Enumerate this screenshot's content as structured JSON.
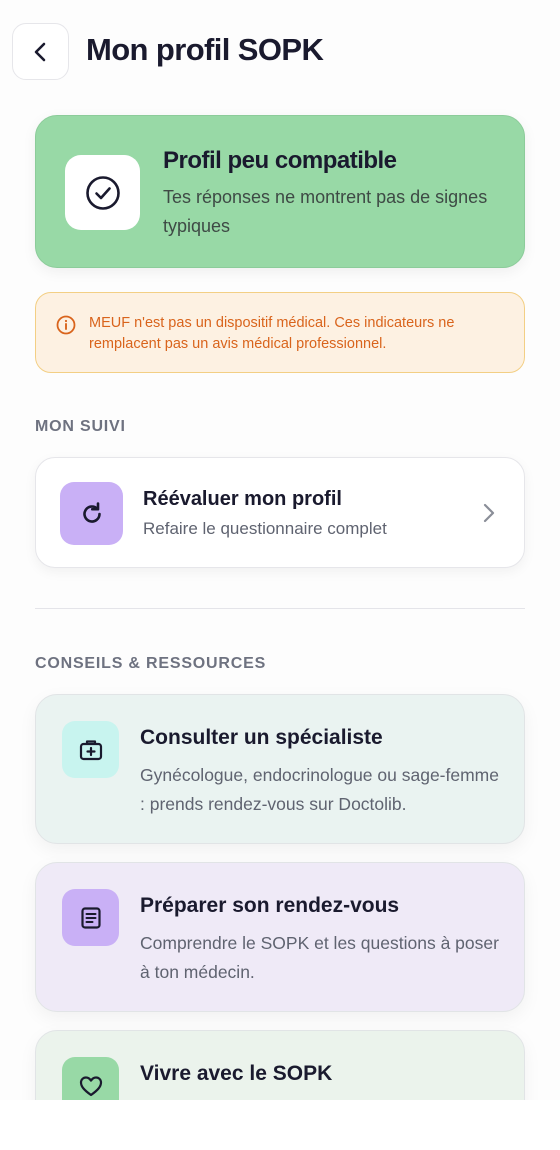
{
  "header": {
    "title": "Mon profil SOPK",
    "back_icon": "chevron-left-icon"
  },
  "status": {
    "title": "Profil peu compatible",
    "description": "Tes réponses ne montrent pas de signes typiques",
    "icon": "check-circle-icon",
    "color": "#98d9a6"
  },
  "warning": {
    "text": "MEUF n'est pas un dispositif médical. Ces indicateurs ne remplacent pas un avis médical professionnel.",
    "icon": "info-icon",
    "color": "#d9641c"
  },
  "suivi": {
    "section_label": "MON SUIVI",
    "reevaluate": {
      "title": "Réévaluer mon profil",
      "subtitle": "Refaire le questionnaire complet",
      "icon": "refresh-icon"
    }
  },
  "resources": {
    "section_label": "CONSEILS & RESSOURCES",
    "items": [
      {
        "title": "Consulter un spécialiste",
        "description": "Gynécologue, endocrinologue ou sage-femme : prends rendez-vous sur Doctolib.",
        "icon": "medical-kit-icon"
      },
      {
        "title": "Préparer son rendez-vous",
        "description": "Comprendre le SOPK et les questions à poser à ton médecin.",
        "icon": "document-icon"
      },
      {
        "title": "Vivre avec le SOPK",
        "description": "",
        "icon": "heart-icon"
      }
    ]
  }
}
